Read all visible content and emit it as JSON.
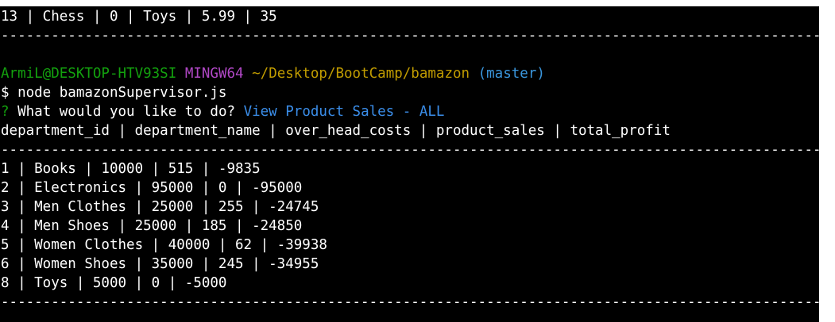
{
  "terminal": {
    "top_row": "13 | Chess | 0 | Toys | 5.99 | 35",
    "divider1": "---------------------------------------------------------------------------------------------------",
    "prompt": {
      "user_host": "ArmiL@DESKTOP-HTV93SI",
      "shell": "MINGW64",
      "path": "~/Desktop/BootCamp/bamazon",
      "branch": "(master)"
    },
    "command": "$ node bamazonSupervisor.js",
    "question_mark": "?",
    "question": " What would you like to do? ",
    "answer": "View Product Sales - ALL",
    "header": "department_id | department_name | over_head_costs | product_sales | total_profit",
    "divider2": "---------------------------------------------------------------------------------------------------",
    "rows": [
      "1 | Books | 10000 | 515 | -9835",
      "2 | Electronics | 95000 | 0 | -95000",
      "3 | Men Clothes | 25000 | 255 | -24745",
      "4 | Men Shoes | 25000 | 185 | -24850",
      "5 | Women Clothes | 40000 | 62 | -39938",
      "6 | Women Shoes | 35000 | 245 | -34955",
      "8 | Toys | 5000 | 0 | -5000"
    ],
    "divider3": "---------------------------------------------------------------------------------------------------"
  }
}
